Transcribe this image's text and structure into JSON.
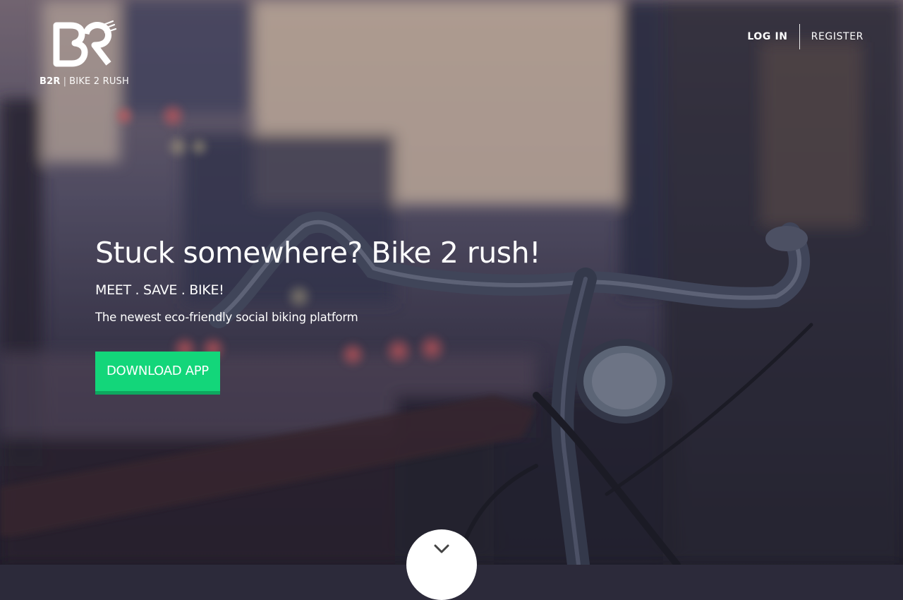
{
  "brand": {
    "short": "B2R",
    "separator": "|",
    "name": "BIKE 2 RUSH",
    "logo_icon": "b2r-logo-icon"
  },
  "nav": {
    "login": "LOG IN",
    "register": "REGISTER"
  },
  "hero": {
    "headline": "Stuck somewhere? Bike 2 rush!",
    "tagline": "MEET . SAVE . BIKE!",
    "subtitle": "The newest eco-friendly social biking platform",
    "cta": "DOWNLOAD APP",
    "cta_color": "#13d67a"
  },
  "scroll": {
    "icon": "chevron-down-icon"
  }
}
